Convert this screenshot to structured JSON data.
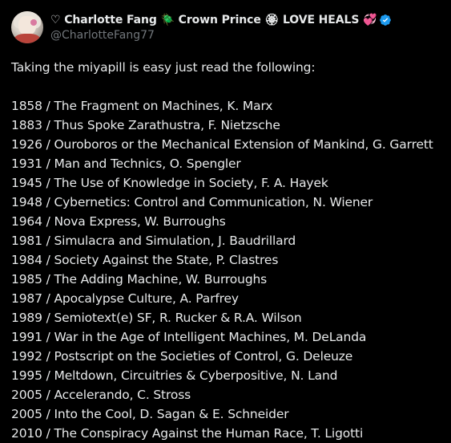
{
  "tweet": {
    "display_name": "♡ Charlotte Fang 🪲 Crown Prince 🏵 LOVE HEALS 💞",
    "handle": "@CharlotteFang77",
    "intro": "Taking the miyapill is easy just read the following:",
    "reading_list": [
      "1858 / The Fragment on Machines, K. Marx",
      "1883 / Thus Spoke Zarathustra, F. Nietzsche",
      "1926 / Ouroboros or the Mechanical Extension of Mankind, G. Garrett",
      "1931 / Man and Technics, O. Spengler",
      "1945 / The Use of Knowledge in Society, F. A. Hayek",
      "1948 / Cybernetics: Control and Communication, N. Wiener",
      "1964 / Nova Express, W. Burroughs",
      "1981 / Simulacra and Simulation, J. Baudrillard",
      "1984 / Society Against the State, P. Clastres",
      "1985 / The Adding Machine, W. Burroughs",
      "1987 / Apocalypse Culture, A. Parfrey",
      "1989 / Semiotext(e) SF, R. Rucker & R.A. Wilson",
      "1991 / War in the Age of Intelligent Machines, M. DeLanda",
      "1992 / Postscript on the Societies of Control, G. Deleuze",
      "1995 / Meltdown, Circuitries & Cyberpositive, N. Land",
      "2005 / Accelerando, C. Stross",
      "2005 / Into the Cool, D. Sagan & E. Schneider",
      "2010 / The Conspiracy Against the Human Race, T. Ligotti"
    ]
  },
  "colors": {
    "background": "#000000",
    "text_primary": "#e7e9ea",
    "text_secondary": "#71767b",
    "verified_badge": "#1d9bf0"
  },
  "icons": {
    "verified": "verified-badge-icon",
    "avatar": "profile-avatar"
  }
}
